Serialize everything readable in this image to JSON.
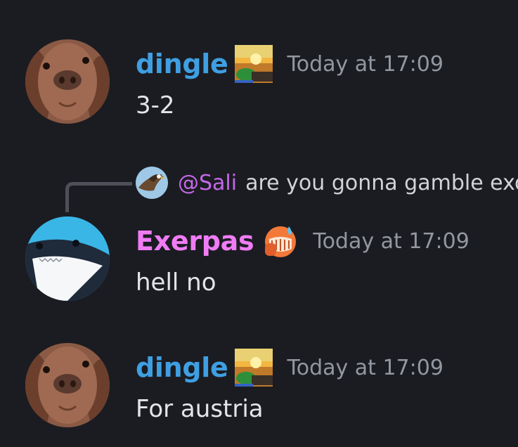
{
  "messages": [
    {
      "username": "dingle",
      "timestamp": "Today at 17:09",
      "text": "3-2",
      "avatar_icon": "dog-avatar-icon",
      "role_icon": "sunset-icon",
      "name_color": "#3f9fe2"
    },
    {
      "reply": {
        "mention": "@Sali",
        "text": "are you gonna gamble exo",
        "avatar_icon": "eagle-avatar-icon"
      },
      "username": "Exerpas",
      "timestamp": "Today at 17:09",
      "text": "hell no",
      "avatar_icon": "shark-avatar-icon",
      "role_icon": "sweating-emoji-icon",
      "name_color": "#f07cf5"
    },
    {
      "username": "dingle",
      "timestamp": "Today at 17:09",
      "text": "For austria",
      "avatar_icon": "dog-avatar-icon",
      "role_icon": "sunset-icon",
      "name_color": "#3f9fe2"
    }
  ],
  "colors": {
    "background": "#1b1c21",
    "timestamp": "#9297a0",
    "mention": "#c468e8"
  }
}
